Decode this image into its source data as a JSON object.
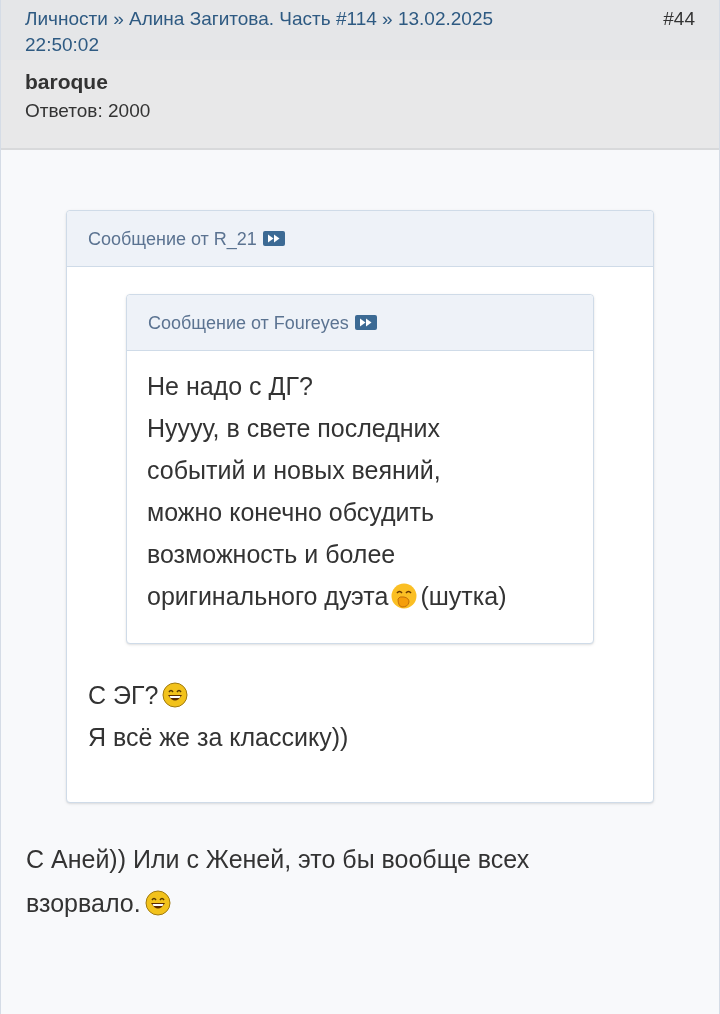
{
  "post": {
    "breadcrumb": "Личности » Алина Загитова. Часть #114 » 13.02.2025 22:50:02",
    "number": "#44",
    "author": "baroque",
    "replies": "Ответов: 2000"
  },
  "quote": {
    "title": "Сообщение от R_21",
    "quote": {
      "title": "Сообщение от Foureyes",
      "lines": [
        [
          {
            "kind": "text",
            "text": "Не надо с ДГ?"
          }
        ],
        [
          {
            "kind": "text",
            "text": "Нуууу, в свете последних"
          }
        ],
        [
          {
            "kind": "text",
            "text": "событий и новых веяний,"
          }
        ],
        [
          {
            "kind": "text",
            "text": "можно конечно обсудить"
          }
        ],
        [
          {
            "kind": "text",
            "text": "возможность и более"
          }
        ],
        [
          {
            "kind": "text",
            "text": "оригинального дуэта"
          },
          {
            "kind": "giggle"
          },
          {
            "kind": "text",
            "text": "(шутка)"
          }
        ]
      ]
    },
    "lines": [
      [
        {
          "kind": "text",
          "text": "С ЭГ?"
        },
        {
          "kind": "laugh"
        }
      ],
      [
        {
          "kind": "text",
          "text": "Я всё же за классику))"
        }
      ]
    ]
  },
  "lines": [
    [
      {
        "kind": "text",
        "text": "С Аней)) Или с Женей, это бы вообще всех"
      }
    ],
    [
      {
        "kind": "text",
        "text": "взорвало."
      },
      {
        "kind": "laugh"
      }
    ]
  ]
}
